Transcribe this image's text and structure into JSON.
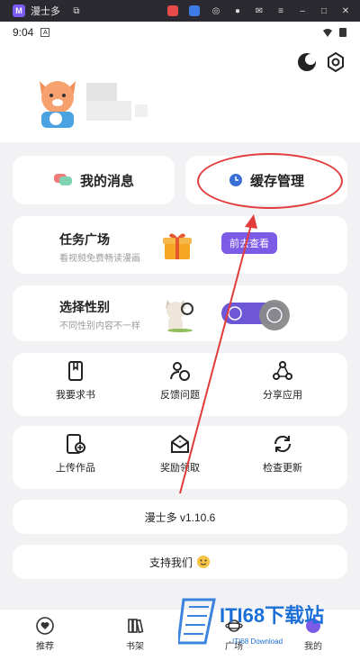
{
  "window": {
    "title": "漫士多"
  },
  "status": {
    "time": "9:04"
  },
  "menu": {
    "messages_label": "我的消息",
    "cache_label": "缓存管理",
    "task": {
      "title": "任务广场",
      "subtitle": "看视频免费畅读漫画",
      "button": "前去查看"
    },
    "gender": {
      "title": "选择性别",
      "subtitle": "不同性别内容不一样"
    },
    "grid1": [
      "我要求书",
      "反馈问题",
      "分享应用"
    ],
    "grid2": [
      "上传作品",
      "奖励领取",
      "检查更新"
    ],
    "version": "漫士多 v1.10.6",
    "support": "支持我们"
  },
  "nav": {
    "items": [
      "推荐",
      "书架",
      "广场",
      "我的"
    ]
  },
  "watermark": {
    "text": "ITI68下载站",
    "sub": "ITI68 Download"
  },
  "colors": {
    "accent": "#7c5ce6",
    "annotation": "#e23b3b",
    "bg": "#f2f2f4"
  }
}
